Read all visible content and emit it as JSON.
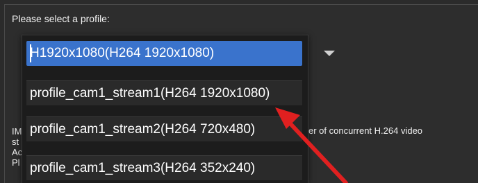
{
  "dialog": {
    "prompt": "Please select a profile:"
  },
  "profile_select": {
    "selected": "H1920x1080(H264 1920x1080)",
    "options": [
      "profile_cam1_stream1(H264 1920x1080)",
      "profile_cam1_stream2(H264 720x480)",
      "profile_cam1_stream3(H264 352x240)"
    ]
  },
  "background_text": {
    "left_fragment": "IM\nst\nAc\nPl",
    "right_fragment": "er of concurrent H.264 video"
  },
  "colors": {
    "selected_bg": "#3a73cc",
    "annotation_arrow": "#e02020"
  },
  "icons": {
    "dropdown": "caret-down-icon",
    "annotation": "red-arrow-icon"
  }
}
